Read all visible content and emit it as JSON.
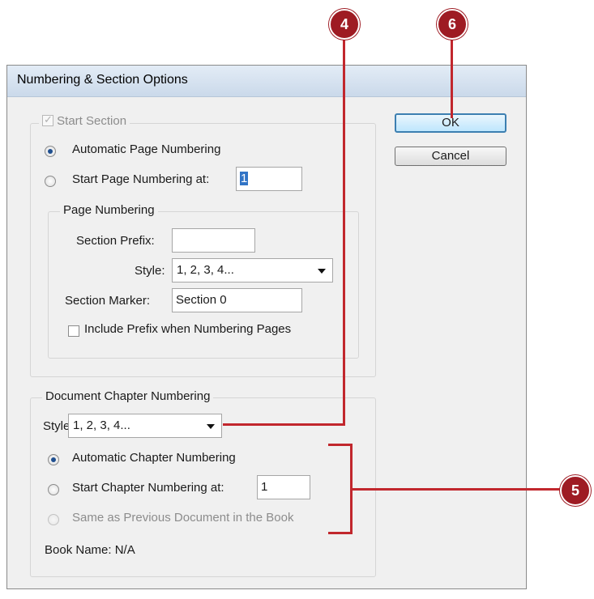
{
  "dialog": {
    "title": "Numbering & Section Options",
    "ok_label": "OK",
    "cancel_label": "Cancel"
  },
  "start_section": {
    "label": "Start Section",
    "checked": true,
    "auto_page_numbering_label": "Automatic Page Numbering",
    "start_page_numbering_label": "Start Page Numbering at:",
    "start_page_value": "1"
  },
  "page_numbering": {
    "legend": "Page Numbering",
    "section_prefix_label": "Section Prefix:",
    "section_prefix_value": "",
    "style_label": "Style:",
    "style_value": "1, 2, 3, 4...",
    "section_marker_label": "Section Marker:",
    "section_marker_value": "Section 0",
    "include_prefix_label": "Include Prefix when Numbering Pages"
  },
  "chapter_numbering": {
    "legend": "Document Chapter Numbering",
    "style_label": "Style:",
    "style_value": "1, 2, 3, 4...",
    "auto_chapter_label": "Automatic Chapter Numbering",
    "start_chapter_label": "Start Chapter Numbering at:",
    "start_chapter_value": "1",
    "same_as_previous_label": "Same as Previous Document in the Book",
    "book_name_label": "Book Name: N/A"
  },
  "callouts": {
    "four": "4",
    "five": "5",
    "six": "6"
  },
  "colors": {
    "callout": "#9e1b23",
    "line": "#c1272d",
    "accent": "#3c7fb1"
  }
}
